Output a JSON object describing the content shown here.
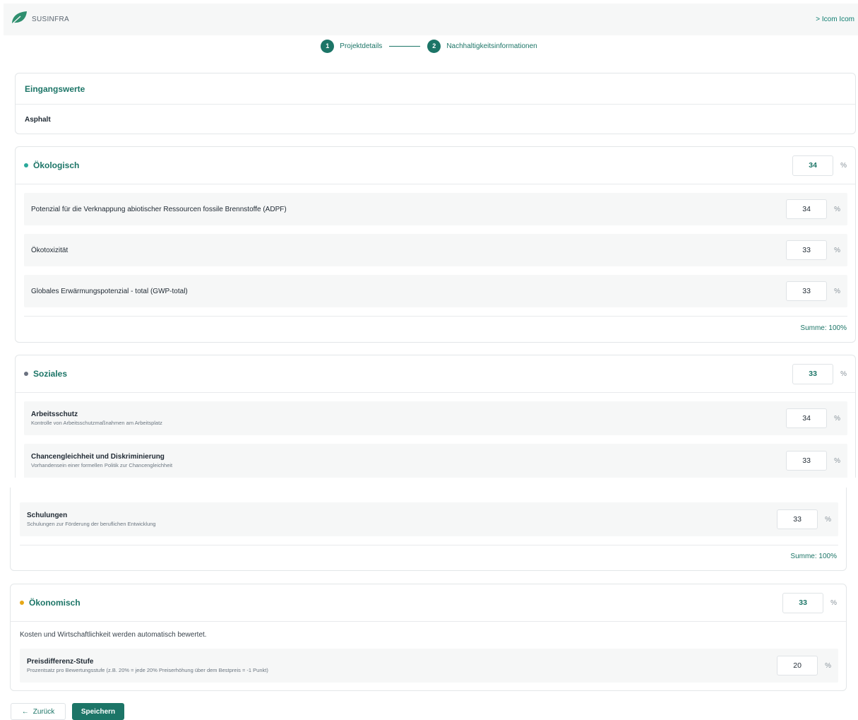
{
  "header": {
    "brand": "SUSINFRA",
    "user": "> Icom Icom"
  },
  "stepper": [
    {
      "num": "1",
      "label": "Projektdetails"
    },
    {
      "num": "2",
      "label": "Nachhaltigkeitsinformationen"
    }
  ],
  "eingang": {
    "title": "Eingangswerte",
    "material": "Asphalt"
  },
  "oeko": {
    "title": "Ökologisch",
    "percent": "34",
    "unit": "%",
    "dot_color": "#2aa89a",
    "items": [
      {
        "title": "Potenzial für die Verknappung abiotischer Ressourcen fossile Brennstoffe (ADPF)",
        "value": "34"
      },
      {
        "title": "Ökotoxizität",
        "value": "33"
      },
      {
        "title": "Globales Erwärmungspotenzial - total (GWP-total)",
        "value": "33"
      }
    ],
    "summe": "Summe: 100%"
  },
  "sozial": {
    "title": "Soziales",
    "percent": "33",
    "unit": "%",
    "dot_color": "#6b7280",
    "items": [
      {
        "title": "Arbeitsschutz",
        "sub": "Kontrolle von Arbeitsschutzmaßnahmen am Arbeitsplatz",
        "value": "34"
      },
      {
        "title": "Chancengleichheit und Diskriminierung",
        "sub": "Vorhandensein einer formellen Politik zur Chancengleichheit",
        "value": "33"
      },
      {
        "title": "Schulungen",
        "sub": "Schulungen zur Förderung der beruflichen Entwicklung",
        "value": "33"
      }
    ],
    "summe": "Summe: 100%"
  },
  "oekon": {
    "title": "Ökonomisch",
    "percent": "33",
    "unit": "%",
    "dot_color": "#e6a817",
    "note": "Kosten und Wirtschaftlichkeit werden automatisch bewertet.",
    "item": {
      "title": "Preisdifferenz-Stufe",
      "sub": "Prozentsatz pro Bewertungsstufe (z.B. 20% = jede 20% Preiserhöhung über dem Bestpreis = -1 Punkt)",
      "value": "20"
    }
  },
  "buttons": {
    "back": "Zurück",
    "back_icon": "←",
    "save": "Speichern"
  },
  "colors": {
    "accent": "#1c7567"
  }
}
